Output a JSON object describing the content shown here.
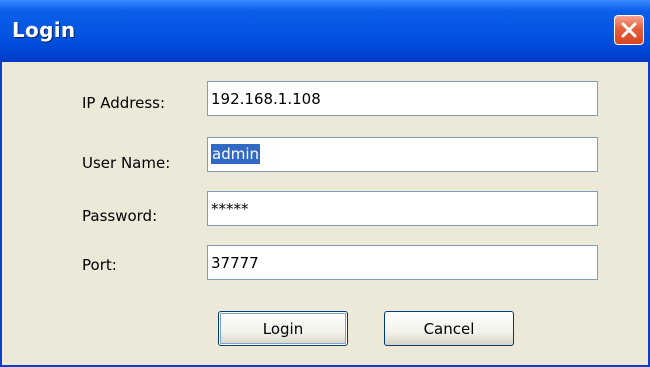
{
  "window": {
    "title": "Login",
    "close_icon": "close-icon",
    "accent_color": "#0556e3",
    "close_color": "#d8451f"
  },
  "form": {
    "ip_label": "IP Address:",
    "ip_value": "192.168.1.108",
    "username_label": "User Name:",
    "username_value": "admin",
    "password_label": "Password:",
    "password_value": "*****",
    "port_label": "Port:",
    "port_value": "37777"
  },
  "buttons": {
    "login_label": "Login",
    "cancel_label": "Cancel"
  }
}
